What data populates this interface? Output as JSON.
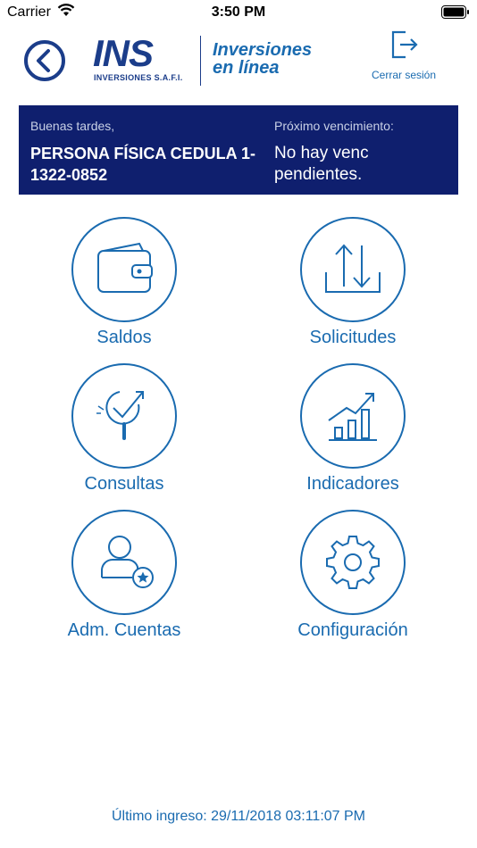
{
  "status_bar": {
    "carrier": "Carrier",
    "time": "3:50 PM"
  },
  "header": {
    "logo_text": "INS",
    "logo_subtext": "INVERSIONES S.A.F.I.",
    "title_line1": "Inversiones",
    "title_line2": "en línea",
    "logout_label": "Cerrar sesión"
  },
  "banner": {
    "greeting": "Buenas tardes,",
    "user_name": "PERSONA FÍSICA CEDULA 1-1322-0852",
    "due_label": "Próximo vencimiento:",
    "due_value": "No hay venc pendientes."
  },
  "menu": [
    {
      "id": "saldos",
      "label": "Saldos",
      "icon": "wallet-icon"
    },
    {
      "id": "solicitudes",
      "label": "Solicitudes",
      "icon": "transfer-arrows-icon"
    },
    {
      "id": "consultas",
      "label": "Consultas",
      "icon": "magnifier-check-icon"
    },
    {
      "id": "indicadores",
      "label": "Indicadores",
      "icon": "bar-chart-growth-icon"
    },
    {
      "id": "adm-cuentas",
      "label": "Adm. Cuentas",
      "icon": "user-star-icon"
    },
    {
      "id": "configuracion",
      "label": "Configuración",
      "icon": "gear-icon"
    }
  ],
  "footer": {
    "last_login": "Último ingreso: 29/11/2018 03:11:07 PM"
  },
  "colors": {
    "accent": "#1a6bb0",
    "brand_dark": "#1b3d8a",
    "banner_bg": "#0f1f6e"
  }
}
